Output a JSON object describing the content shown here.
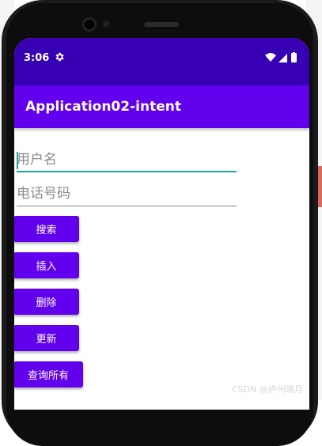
{
  "status_bar": {
    "time": "3:06"
  },
  "app_bar": {
    "title": "Application02-intent"
  },
  "form": {
    "username_placeholder": "用户名",
    "phone_placeholder": "电话号码"
  },
  "buttons": {
    "search": "搜索",
    "insert": "插入",
    "delete": "删除",
    "update": "更新",
    "query_all": "查询所有"
  },
  "watermark": "CSDN @庐州晴月",
  "colors": {
    "status_bar": "#3700b3",
    "app_bar": "#6200ee",
    "button": "#6200ee",
    "accent": "#1aa79a"
  }
}
